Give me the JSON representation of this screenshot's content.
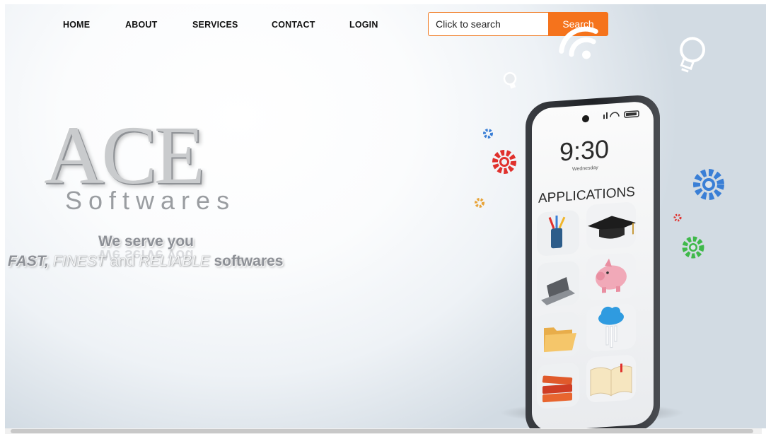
{
  "nav": {
    "items": [
      {
        "label": "HOME"
      },
      {
        "label": "ABOUT"
      },
      {
        "label": "SERVICES"
      },
      {
        "label": "CONTACT"
      },
      {
        "label": "LOGIN"
      }
    ]
  },
  "search": {
    "placeholder": "Click to search",
    "button_label": "Search"
  },
  "logo": {
    "title": "ACE",
    "subtitle": "Softwares"
  },
  "tagline": {
    "line1": "We serve you",
    "fast": "FAST,",
    "finest": "FINEST",
    "and": "and",
    "reliable": "RELIABLE",
    "softwares": "softwares"
  },
  "phone": {
    "time": "9:30",
    "day": "Wednesday",
    "heading": "APPLICATIONS"
  },
  "colors": {
    "accent": "#f5731c",
    "gear_blue": "#3a7fd6",
    "gear_red": "#e0312d",
    "gear_green": "#3fb94a",
    "gear_orange": "#e8a43a"
  },
  "icons": [
    "wifi-icon",
    "lightbulb-icon",
    "gear-icon",
    "pencil-cup-icon",
    "graduation-cap-icon",
    "laptop-icon",
    "piggy-bank-icon",
    "folder-icon",
    "cloud-icon",
    "books-icon",
    "open-book-icon"
  ]
}
